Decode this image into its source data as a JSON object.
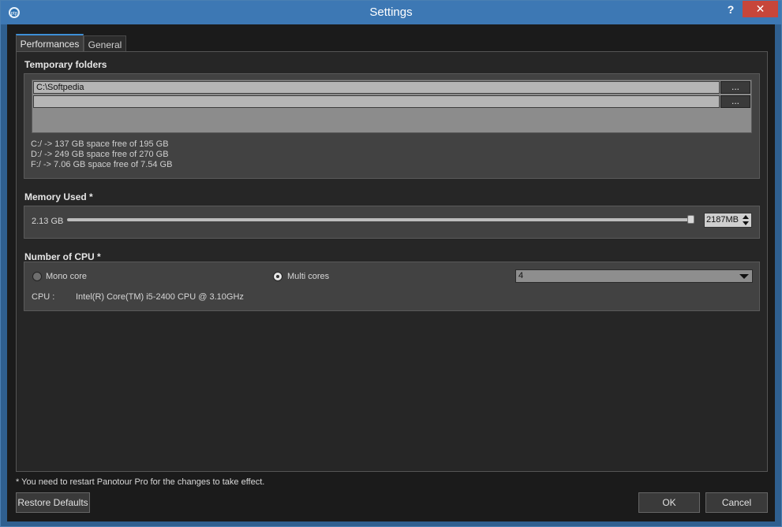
{
  "window": {
    "title": "Settings",
    "help_label": "?",
    "close_label": "✕"
  },
  "tabs": [
    {
      "label": "Performances",
      "active": true
    },
    {
      "label": "General",
      "active": false
    }
  ],
  "temporary_folders": {
    "title": "Temporary folders",
    "rows": [
      {
        "path": "C:\\Softpedia",
        "browse_label": "..."
      },
      {
        "path": "",
        "browse_label": "..."
      }
    ],
    "drives": [
      "C:/ -> 137 GB space free of 195 GB",
      "D:/ -> 249 GB space free of 270 GB",
      "F:/ -> 7.06 GB space free of 7.54 GB"
    ]
  },
  "memory": {
    "title": "Memory Used *",
    "current_label": "2.13 GB",
    "spin_value": "2187MB",
    "slider_fraction": 0.995
  },
  "cpu": {
    "title": "Number of CPU *",
    "mono_label": "Mono core",
    "multi_label": "Multi cores",
    "selected": "multi",
    "cores_value": "4",
    "cpu_label": "CPU :",
    "cpu_name": "Intel(R) Core(TM) i5-2400 CPU @ 3.10GHz"
  },
  "footer": {
    "note": "* You need to restart Panotour Pro for the changes to take effect.",
    "restore_label": "Restore Defaults",
    "ok_label": "OK",
    "cancel_label": "Cancel"
  },
  "colors": {
    "accent": "#3d8fd6",
    "close": "#c7463a"
  }
}
